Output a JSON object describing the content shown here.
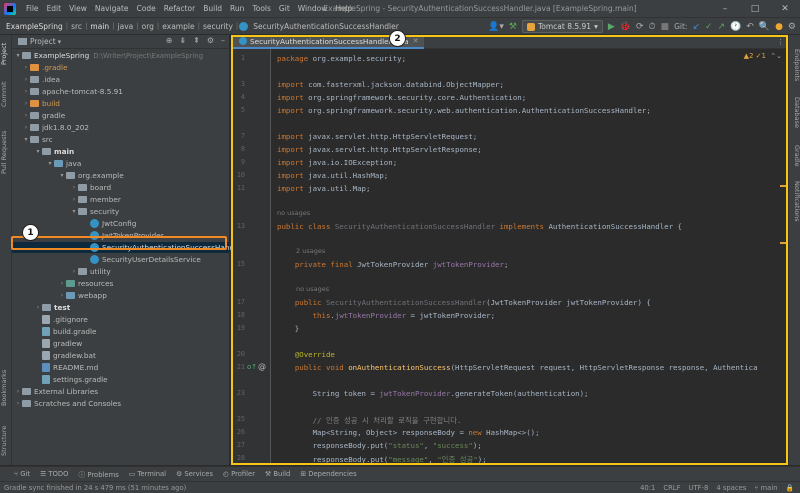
{
  "window": {
    "title": "ExampleSpring - SecurityAuthenticationSuccessHandler.java [ExampleSpring.main]"
  },
  "menu": [
    "File",
    "Edit",
    "View",
    "Navigate",
    "Code",
    "Refactor",
    "Build",
    "Run",
    "Tools",
    "Git",
    "Window",
    "Help"
  ],
  "breadcrumb": [
    "ExampleSpring",
    "src",
    "main",
    "java",
    "org",
    "example",
    "security",
    "SecurityAuthenticationSuccessHandler"
  ],
  "toolbar": {
    "run_config": "Tomcat 8.5.91",
    "git_label": "Git:"
  },
  "project_panel": {
    "title": "Project",
    "tree": [
      {
        "label": "ExampleSpring",
        "extra": "D:\\Writer\\Project\\ExampleSpring",
        "icon": "folder-gray"
      },
      {
        "label": ".gradle",
        "icon": "folder-orange"
      },
      {
        "label": ".idea",
        "icon": "folder-gray"
      },
      {
        "label": "apache-tomcat-8.5.91",
        "icon": "folder-gray"
      },
      {
        "label": "build",
        "icon": "folder-orange"
      },
      {
        "label": "gradle",
        "icon": "folder-gray"
      },
      {
        "label": "jdk1.8.0_202",
        "icon": "folder-gray"
      },
      {
        "label": "src",
        "icon": "folder-gray"
      },
      {
        "label": "main",
        "icon": "folder-gray"
      },
      {
        "label": "java",
        "icon": "folder-blue"
      },
      {
        "label": "org.example",
        "icon": "folder-gray"
      },
      {
        "label": "board",
        "icon": "folder-gray"
      },
      {
        "label": "member",
        "icon": "folder-gray"
      },
      {
        "label": "security",
        "icon": "folder-gray"
      },
      {
        "label": "JwtConfig",
        "icon": "class"
      },
      {
        "label": "JwtTokenProvider",
        "icon": "class"
      },
      {
        "label": "SecurityAuthenticationSuccessHandler",
        "icon": "class",
        "selected": true
      },
      {
        "label": "SecurityUserDetailsService",
        "icon": "class"
      },
      {
        "label": "utility",
        "icon": "folder-gray"
      },
      {
        "label": "resources",
        "icon": "folder-teal"
      },
      {
        "label": "webapp",
        "icon": "folder-blue"
      },
      {
        "label": "test",
        "icon": "folder-gray"
      },
      {
        "label": ".gitignore",
        "icon": "file"
      },
      {
        "label": "build.gradle",
        "icon": "file"
      },
      {
        "label": "gradlew",
        "icon": "file"
      },
      {
        "label": "gradlew.bat",
        "icon": "file"
      },
      {
        "label": "README.md",
        "icon": "file"
      },
      {
        "label": "settings.gradle",
        "icon": "file"
      },
      {
        "label": "External Libraries",
        "icon": "folder-gray"
      },
      {
        "label": "Scratches and Consoles",
        "icon": "folder-gray"
      }
    ]
  },
  "editor": {
    "tab_label": "SecurityAuthenticationSuccessHandler.java",
    "inspection": "▲2 ✓1",
    "hints": {
      "no_usages": "no usages",
      "two_usages": "2 usages"
    },
    "code": {
      "l1_pkg": "org.example.security",
      "l3": "com.fasterxml.jackson.databind.ObjectMapper;",
      "l4": "org.springframework.security.core.Authentication;",
      "l5": "org.springframework.security.web.authentication.AuthenticationSuccessHandler;",
      "l7": "javax.servlet.http.HttpServletRequest;",
      "l8": "javax.servlet.http.HttpServletResponse;",
      "l9": "java.io.IOException;",
      "l10": "java.util.HashMap;",
      "l11": "java.util.Map;",
      "l13_class": "SecurityAuthenticationSuccessHandler",
      "l13_iface": "AuthenticationSuccessHandler",
      "l15_type": "JwtTokenProvider",
      "l15_field": "jwtTokenProvider",
      "l17_ctor": "SecurityAuthenticationSuccessHandler",
      "l17_params": "(JwtTokenProvider jwtTokenProvider) {",
      "l18_rhs": "jwtTokenProvider;",
      "l20_ann": "@Override",
      "l21_method": "onAuthenticationSuccess",
      "l21_params": "(HttpServletRequest request, HttpServletResponse response, Authentica",
      "l23_call": "generateToken",
      "l23_arg": "(authentication);",
      "l25_comment": "// 인증 성공 시 처리할 로직을 구현합니다.",
      "l26_type": "Map<String, Object> responseBody = ",
      "l26_rhs": "HashMap<>();",
      "l27_key": "\"status\"",
      "l27_val": "\"success\"",
      "l28_key": "\"message\"",
      "l28_val": "\"인증 성공\""
    }
  },
  "left_tabs": [
    "Project",
    "Commit",
    "Pull Requests",
    "Bookmarks",
    "Structure"
  ],
  "right_tabs": [
    "Endpoints",
    "Database",
    "Gradle",
    "Notifications"
  ],
  "tool_windows": [
    "Git",
    "TODO",
    "Problems",
    "Terminal",
    "Services",
    "Profiler",
    "Build",
    "Dependencies"
  ],
  "status": {
    "message": "Gradle sync finished in 24 s 479 ms (51 minutes ago)",
    "position": "40:1",
    "line_sep": "CRLF",
    "encoding": "UTF-8",
    "indent": "4 spaces",
    "branch": "main"
  },
  "callouts": [
    "1",
    "2"
  ]
}
